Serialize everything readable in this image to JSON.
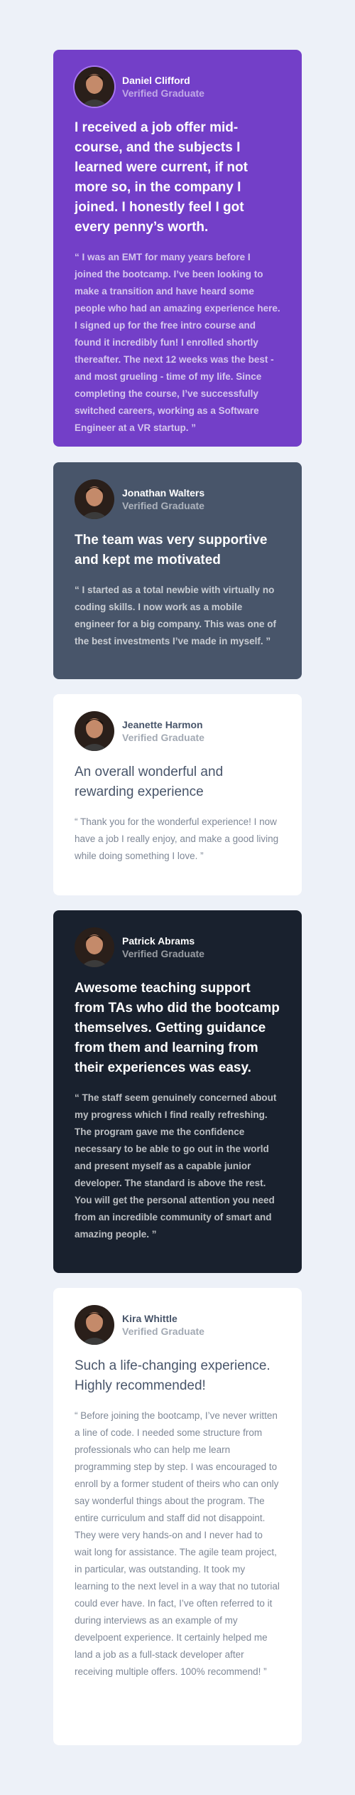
{
  "colors": {
    "background": "#edf1f8",
    "purple": "#733fc8",
    "grayblue": "#48556a",
    "white": "#ffffff",
    "dark": "#19212e"
  },
  "testimonials": [
    {
      "name": "Daniel Clifford",
      "role": "Verified Graduate",
      "headline": "I received a job offer mid-course, and the subjects I learned were current, if not more so, in the company I joined. I honestly feel I got every penny’s worth.",
      "quote": "“ I was an EMT for many years before I joined the bootcamp. I’ve been looking to make a transition and have heard some people who had an amazing experience here. I signed up for the free intro course and found it incredibly fun! I enrolled shortly thereafter. The next 12 weeks was the best - and most grueling - time of my life. Since completing the course, I’ve successfully switched careers, working as a Software Engineer at a VR startup. ”"
    },
    {
      "name": "Jonathan Walters",
      "role": "Verified Graduate",
      "headline": "The team was very supportive and kept me motivated",
      "quote": "“ I started as a total newbie with virtually no coding skills. I now work as a mobile engineer for a big company. This was one of the best investments I’ve made in myself. ”"
    },
    {
      "name": "Jeanette Harmon",
      "role": "Verified Graduate",
      "headline": "An overall wonderful and rewarding experience",
      "quote": "“ Thank you for the wonderful experience! I now have a job I really enjoy, and make a good living while doing something I love. ”"
    },
    {
      "name": "Patrick Abrams",
      "role": "Verified Graduate",
      "headline": "Awesome teaching support from TAs who did the bootcamp themselves. Getting guidance from them and learning from their experiences was easy.",
      "quote": "“ The staff seem genuinely concerned about my progress which I find really refreshing. The program gave me the confidence necessary to be able to go out in the world and present myself as a capable junior developer. The standard is above the rest. You will get the personal attention you need from an incredible community of smart and amazing people. ”"
    },
    {
      "name": "Kira Whittle",
      "role": "Verified Graduate",
      "headline": "Such a life-changing experience. Highly recommended!",
      "quote": "“ Before joining the bootcamp, I’ve never written a line of code. I needed some structure from professionals who can help me learn programming step by step. I was encouraged to enroll by a former student of theirs who can only say wonderful things about the program. The entire curriculum and staff did not disappoint. They were very hands-on and I never had to wait long for assistance. The agile team project, in particular, was outstanding. It took my learning to the next level in a way that no tutorial could ever have. In fact, I’ve often referred to it during interviews as an example of my develpoent experience. It certainly helped me land a job as a full-stack developer after receiving multiple offers. 100% recommend! ”"
    }
  ]
}
